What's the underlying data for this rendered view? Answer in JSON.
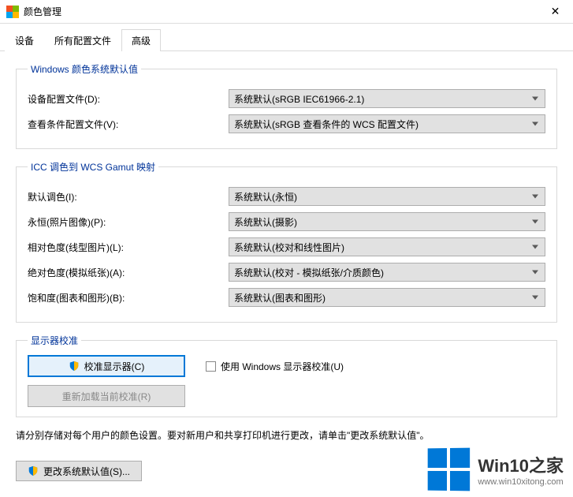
{
  "window": {
    "title": "颜色管理",
    "close": "✕"
  },
  "tabs": {
    "device": "设备",
    "profiles": "所有配置文件",
    "advanced": "高级"
  },
  "section_defaults": {
    "legend": "Windows 颜色系统默认值",
    "device_profile_label": "设备配置文件(D):",
    "device_profile_value": "系统默认(sRGB IEC61966-2.1)",
    "viewing_profile_label": "查看条件配置文件(V):",
    "viewing_profile_value": "系统默认(sRGB 查看条件的 WCS 配置文件)"
  },
  "section_icc": {
    "legend": "ICC 调色到 WCS Gamut 映射",
    "default_intent_label": "默认调色(I):",
    "default_intent_value": "系统默认(永恒)",
    "perpetual_label": "永恒(照片图像)(P):",
    "perpetual_value": "系统默认(摄影)",
    "relative_label": "相对色度(线型图片)(L):",
    "relative_value": "系统默认(校对和线性图片)",
    "absolute_label": "绝对色度(模拟纸张)(A):",
    "absolute_value": "系统默认(校对 - 模拟纸张/介质颜色)",
    "saturation_label": "饱和度(图表和图形)(B):",
    "saturation_value": "系统默认(图表和图形)"
  },
  "section_calib": {
    "legend": "显示器校准",
    "calibrate_btn": "校准显示器(C)",
    "reload_btn": "重新加载当前校准(R)",
    "use_windows_calib": "使用 Windows 显示器校准(U)"
  },
  "note": "请分别存储对每个用户的颜色设置。要对新用户和共享打印机进行更改，请单击\"更改系统默认值\"。",
  "change_defaults_btn": "更改系统默认值(S)...",
  "watermark": {
    "title": "Win10之家",
    "url": "www.win10xitong.com"
  }
}
